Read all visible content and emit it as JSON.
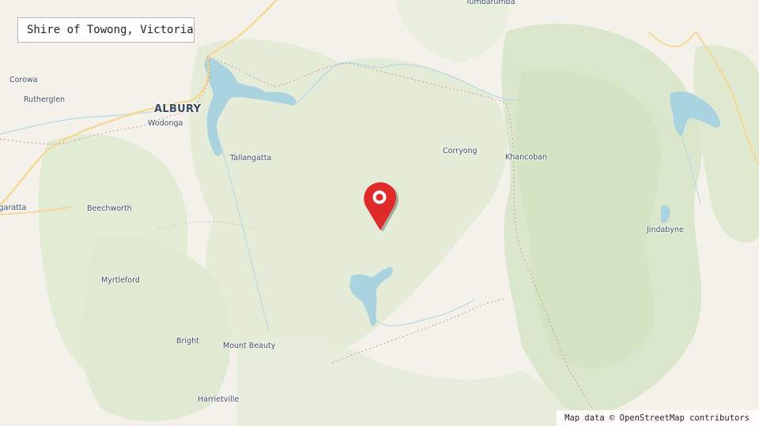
{
  "map": {
    "title": "Shire of Towong, Victoria",
    "attribution": "Map data © OpenStreetMap contributors",
    "marker_icon": "map-pin-icon",
    "colors": {
      "land": "#f3f1ea",
      "forest": "#dde8cf",
      "forest_dark": "#cfe0bd",
      "water": "#a9d3df",
      "road": "#f7d58c",
      "border": "#d29a9a",
      "marker": "#e02a2a"
    }
  },
  "places": {
    "tumbarumba": "Tumbarumba",
    "corowa": "Corowa",
    "rutherglen": "Rutherglen",
    "albury": "ALBURY",
    "wodonga": "Wodonga",
    "tallangatta": "Tallangatta",
    "corryong": "Corryong",
    "khancoban": "Khancoban",
    "wangaratta": "Wangaratta",
    "beechworth": "Beechworth",
    "jindabyne": "Jindabyne",
    "myrtleford": "Myrtleford",
    "bright": "Bright",
    "mount_beauty": "Mount Beauty",
    "harrietville": "Harrietville"
  }
}
